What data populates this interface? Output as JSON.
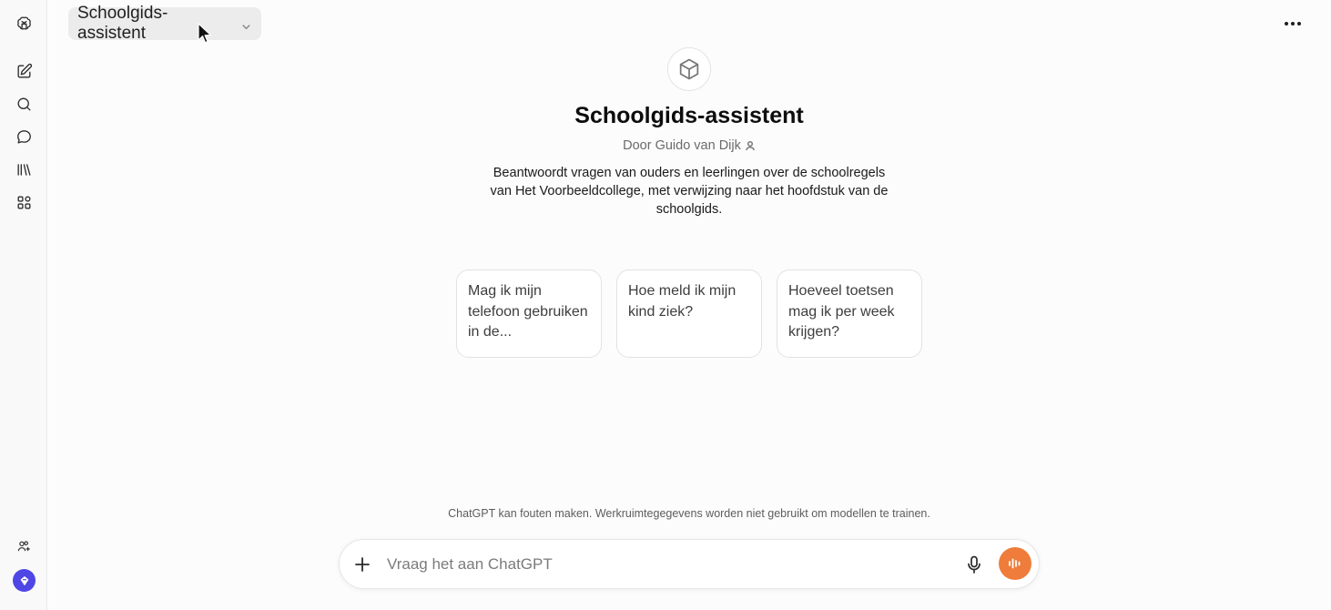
{
  "header": {
    "model_label": "Schoolgids-assistent",
    "more_menu_icon": "ellipsis-icon"
  },
  "sidebar": {
    "items": [
      {
        "name": "openai-logo-icon"
      },
      {
        "name": "new-chat-icon"
      },
      {
        "name": "search-icon"
      },
      {
        "name": "chat-bubble-icon"
      },
      {
        "name": "library-icon"
      },
      {
        "name": "gpts-grid-icon"
      }
    ],
    "bottom": [
      {
        "name": "add-people-icon"
      },
      {
        "name": "profile-badge-icon"
      }
    ]
  },
  "gpt": {
    "title": "Schoolgids-assistent",
    "author": "Door Guido van Dijk",
    "description": "Beantwoordt vragen van ouders en leerlingen over de schoolregels van Het Voorbeeldcollege, met verwijzing naar het hoofdstuk van de schoolgids."
  },
  "starters": [
    "Mag ik mijn telefoon gebruiken in de...",
    "Hoe meld ik mijn kind ziek?",
    "Hoeveel toetsen mag ik per week krijgen?"
  ],
  "footer": {
    "disclaimer": "ChatGPT kan fouten maken. Werkruimtegegevens worden niet gebruikt om modellen te trainen.",
    "composer_placeholder": "Vraag het aan ChatGPT"
  },
  "colors": {
    "voice_button": "#ef7c3a",
    "profile_badge": "#4f46e5"
  }
}
